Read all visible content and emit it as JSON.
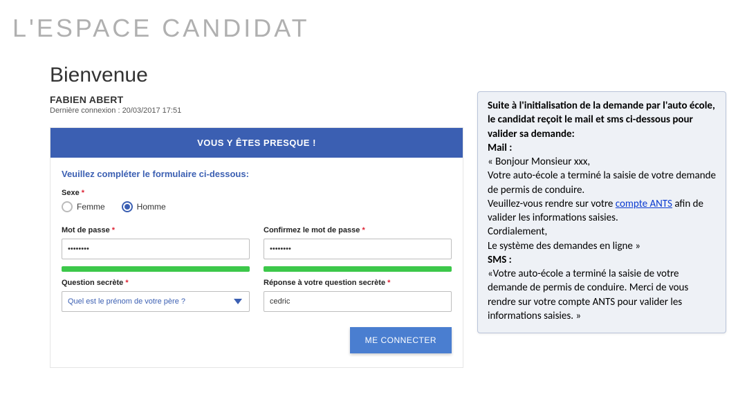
{
  "page_title": "L'espace candidat",
  "welcome": "Bienvenue",
  "user_name": "FABIEN ABERT",
  "last_login_prefix": "Dernière connexion : ",
  "last_login_value": "20/03/2017 17:51",
  "panel_header": "VOUS Y ÊTES PRESQUE !",
  "form_intro": "Veuillez compléter le formulaire ci-dessous:",
  "labels": {
    "sexe": "Sexe",
    "femme": "Femme",
    "homme": "Homme",
    "mdp": "Mot de passe",
    "mdp_confirm": "Confirmez le mot de passe",
    "question": "Question secrète",
    "reponse": "Réponse à votre question secrète"
  },
  "values": {
    "sexe_selected": "homme",
    "mdp": "••••••••",
    "mdp_confirm": "••••••••",
    "question_selected": "Quel est le prénom de votre père ?",
    "reponse": "cedric"
  },
  "button_submit": "ME CONNECTER",
  "infobox": {
    "intro": "Suite à l'initialisation de la demande par l'auto école, le candidat reçoit le mail et sms ci-dessous pour valider sa demande:",
    "mail_label": "Mail :",
    "mail_line1": "«  Bonjour Monsieur xxx,",
    "mail_line2": "Votre auto-école a terminé la saisie de votre demande de permis de conduire.",
    "mail_line3a": "Veuillez-vous rendre sur votre ",
    "mail_link": "compte ANTS",
    "mail_line3b": " afin de valider les informations saisies.",
    "mail_line4": "Cordialement,",
    "mail_line5": "Le système des demandes en ligne »",
    "sms_label": "SMS :",
    "sms_body": "«Votre auto-école a terminé la saisie de votre demande de permis de conduire. Merci de vous rendre sur votre compte ANTS pour valider les informations saisies. »"
  }
}
